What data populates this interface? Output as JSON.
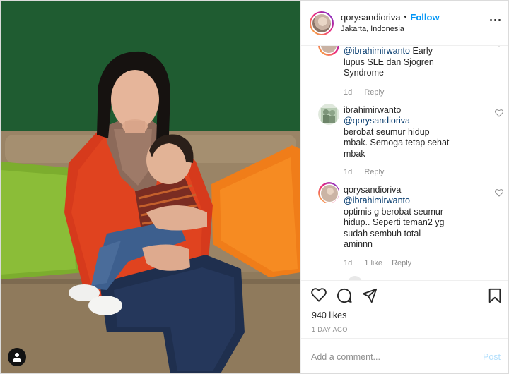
{
  "header": {
    "username": "qorysandioriva",
    "separator": "•",
    "follow_label": "Follow",
    "location": "Jakarta, Indonesia"
  },
  "comments": [
    {
      "username": "",
      "mention": "@ibrahimirwanto",
      "text": "Early lupus SLE dan Sjogren Syndrome",
      "age": "1d",
      "reply": "Reply"
    },
    {
      "username": "ibrahimirwanto",
      "mention": "@qorysandioriva",
      "text": "berobat seumur hidup mbak. Semoga tetap sehat mbak",
      "age": "1d",
      "reply": "Reply"
    },
    {
      "username": "qorysandioriva",
      "mention": "@ibrahimirwanto",
      "text": "optimis g berobat seumur hidup.. Seperti teman2 yg sudah sembuh total aminnn",
      "age": "1d",
      "likes": "1 like",
      "reply": "Reply"
    }
  ],
  "actions": {
    "likes": "940 likes",
    "date": "1 DAY AGO"
  },
  "add_comment": {
    "placeholder": "Add a comment...",
    "post_label": "Post"
  },
  "colors": {
    "accent": "#0095f6",
    "mention": "#00376b",
    "muted": "#8e8e8e",
    "post_disabled": "#b2dffc"
  },
  "icons": [
    "heart-icon",
    "comment-icon",
    "share-icon",
    "bookmark-icon",
    "more-icon",
    "user-tag-icon"
  ]
}
